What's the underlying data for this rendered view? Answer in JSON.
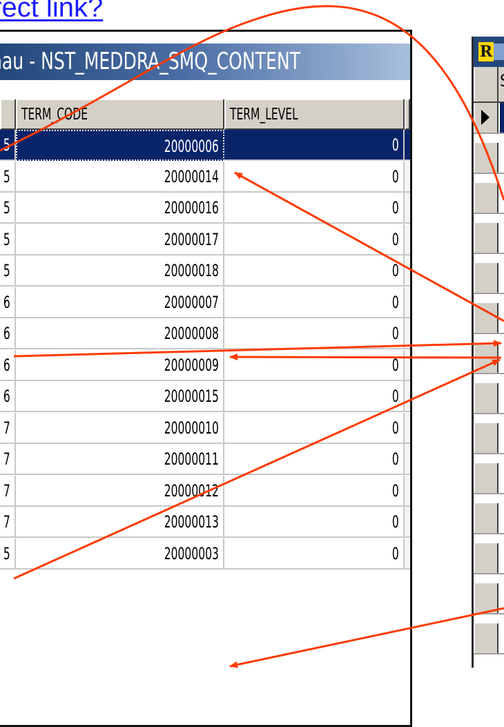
{
  "slide": {
    "title": "direct link?"
  },
  "left_window": {
    "title": "hau - NST_MEDDRA_SMQ_CONTENT",
    "columns": [
      "",
      "TERM_CODE",
      "TERM_LEVEL"
    ],
    "rows": [
      {
        "c0": "5",
        "term_code": "20000006",
        "term_level": "0",
        "selected": true
      },
      {
        "c0": "5",
        "term_code": "20000014",
        "term_level": "0"
      },
      {
        "c0": "5",
        "term_code": "20000016",
        "term_level": "0"
      },
      {
        "c0": "5",
        "term_code": "20000017",
        "term_level": "0"
      },
      {
        "c0": "5",
        "term_code": "20000018",
        "term_level": "0"
      },
      {
        "c0": "6",
        "term_code": "20000007",
        "term_level": "0"
      },
      {
        "c0": "6",
        "term_code": "20000008",
        "term_level": "0"
      },
      {
        "c0": "6",
        "term_code": "20000009",
        "term_level": "0"
      },
      {
        "c0": "6",
        "term_code": "20000015",
        "term_level": "0"
      },
      {
        "c0": "7",
        "term_code": "20000010",
        "term_level": "0"
      },
      {
        "c0": "7",
        "term_code": "20000011",
        "term_level": "0"
      },
      {
        "c0": "7",
        "term_code": "20000012",
        "term_level": "0"
      },
      {
        "c0": "7",
        "term_code": "20000013",
        "term_level": "0"
      },
      {
        "c0": "5",
        "term_code": "20000003",
        "term_level": "0"
      }
    ]
  },
  "right_window": {
    "logo_letter": "R",
    "header_label": "S",
    "rows": 14
  },
  "colors": {
    "arrow": "#ff3b00",
    "selection": "#0a246a",
    "link": "#1a1aff"
  },
  "icons": [
    "record-pointer-icon"
  ]
}
